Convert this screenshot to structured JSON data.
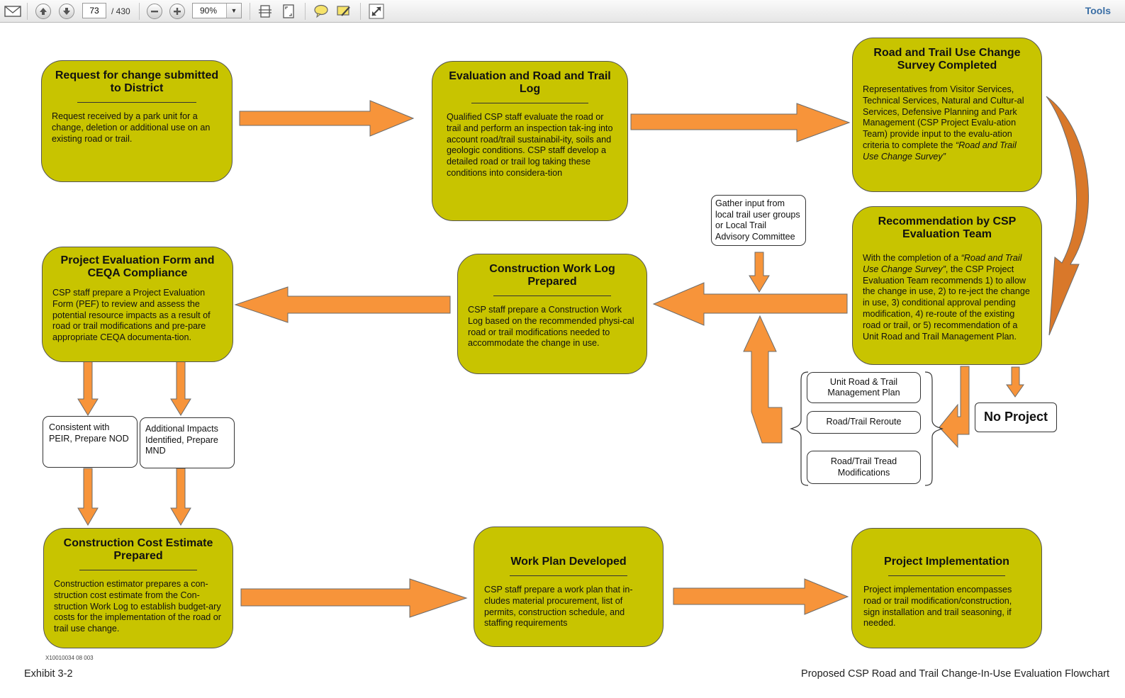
{
  "toolbar": {
    "page_number": "73",
    "page_total": "/ 430",
    "zoom": "90%",
    "tools_label": "Tools"
  },
  "flowchart": {
    "request": {
      "title": "Request for change submitted to District",
      "body": "Request received by a park unit for a change, deletion or additional use on an existing road or trail."
    },
    "evaluation": {
      "title": "Evaluation and Road and Trail Log",
      "body": "Qualified CSP staff evaluate the road or trail and perform an inspection tak-ing into account road/trail sustainabil-ity, soils and geologic conditions. CSP staff develop a detailed road or trail log taking these conditions into considera-tion"
    },
    "survey": {
      "title": "Road and Trail Use Change Survey Completed",
      "body_start": "Representatives from Visitor Services, Technical Services, Natural and Cultur-al Services, Defensive Planning and Park Management (CSP Project Evalu-ation Team) provide input to the evalu-ation criteria to complete the",
      "body_italic": "“Road and Trail Use Change Survey”"
    },
    "gather_input": "Gather input from local trail user groups or Local Trail Advisory Committee",
    "recommendation": {
      "title": "Recommendation by CSP Evaluation Team",
      "body_start": "With the completion of a",
      "body_italic": "“Road and Trail Use Change Survey”",
      "body_end": ", the CSP Project Evaluation Team recommends 1) to allow the change in use, 2) to re-ject the change in use, 3) conditional approval pending modification, 4) re-route of the existing road or trail, or 5) recommendation of a Unit Road and Trail Management Plan."
    },
    "construction_log": {
      "title": "Construction Work Log Prepared",
      "body": "CSP staff prepare a Construction Work Log based on the recommended physi-cal road or trail modifications needed to accommodate the change in use."
    },
    "project_eval": {
      "title": "Project Evaluation Form and CEQA Compliance",
      "body": "CSP staff prepare a Project Evaluation Form (PEF) to review and assess the potential resource impacts as a result of road or trail modifications and pre-pare appropriate CEQA documenta-tion."
    },
    "consistent": "Consistent with PEIR, Prepare NOD",
    "additional": "Additional Impacts Identified, Prepare MND",
    "options": [
      "Unit Road & Trail Management Plan",
      "Road/Trail Reroute",
      "Road/Trail Tread Modifications"
    ],
    "no_project": "No Project",
    "cost_estimate": {
      "title": "Construction Cost Estimate Prepared",
      "body": "Construction estimator prepares a con-struction cost estimate from the Con-struction Work Log to establish budget-ary costs for the implementation of the road or trail use change."
    },
    "work_plan": {
      "title": "Work Plan Developed",
      "body": "CSP staff prepare a work plan that in-cludes material procurement, list of permits, construction schedule, and staffing requirements"
    },
    "implementation": {
      "title": "Project Implementation",
      "body": "Project implementation encompasses road or trail modification/construction, sign installation and trail seasoning, if needed."
    }
  },
  "footer": {
    "code": "X10010034 08 003",
    "exhibit": "Exhibit 3-2",
    "caption": "Proposed CSP Road and Trail Change-In-Use Evaluation Flowchart"
  },
  "colors": {
    "box_fill": "#c8c400",
    "arrow_fill": "#f7943a",
    "curved_arrow_fill": "#d9782a"
  }
}
